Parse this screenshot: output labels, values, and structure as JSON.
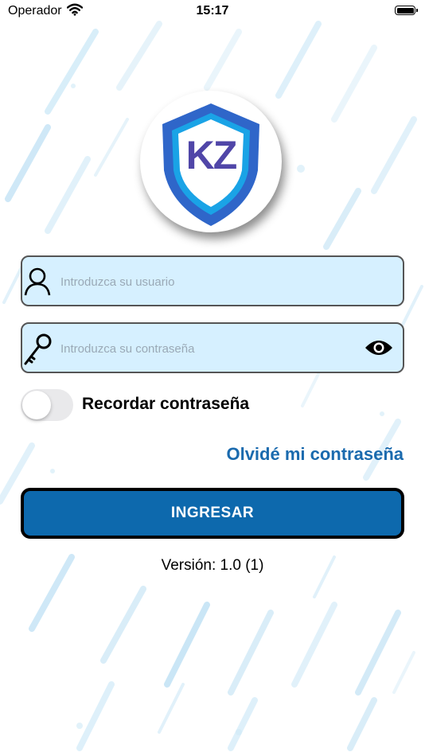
{
  "status_bar": {
    "carrier": "Operador",
    "time": "15:17",
    "icons": [
      "wifi-icon",
      "battery-icon"
    ]
  },
  "logo": {
    "text": "KZ"
  },
  "login_form": {
    "username": {
      "value": "",
      "placeholder": "Introduzca su usuario",
      "icon": "user-icon"
    },
    "password": {
      "value": "",
      "placeholder": "Introduzca su contraseña",
      "icon": "key-icon",
      "reveal_icon": "eye-icon"
    },
    "remember": {
      "label": "Recordar contraseña",
      "on": false
    },
    "forgot_label": "Olvidé mi contraseña",
    "submit_label": "INGRESAR"
  },
  "footer": {
    "version": "Versión: 1.0 (1)"
  },
  "colors": {
    "accent": "#1a6aae",
    "button": "#0d69ad",
    "field_bg": "#d6f0ff",
    "logo_text": "#5046a8",
    "shield_outer": "#2f66c9",
    "shield_inner": "#1aa3e6"
  }
}
